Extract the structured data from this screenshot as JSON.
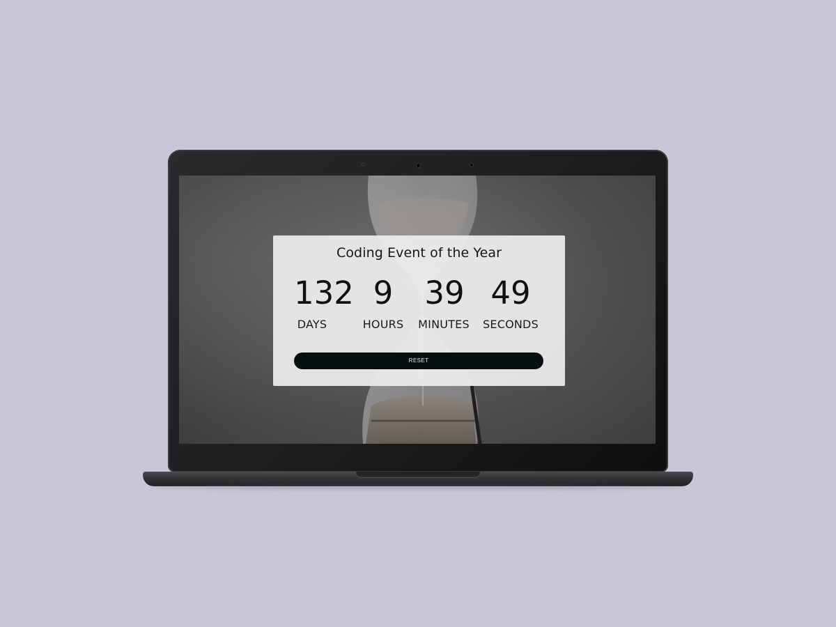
{
  "countdown": {
    "title": "Coding Event of the Year",
    "units": [
      {
        "value": "132",
        "label": "DAYS"
      },
      {
        "value": "9",
        "label": "HOURS"
      },
      {
        "value": "39",
        "label": "MINUTES"
      },
      {
        "value": "49",
        "label": "SECONDS"
      }
    ],
    "reset_label": "RESET"
  },
  "colors": {
    "page_background": "#c8c7d8",
    "panel_background": "#eeeeee",
    "reset_button": "#071010",
    "laptop_body": "#1b1b1d"
  }
}
